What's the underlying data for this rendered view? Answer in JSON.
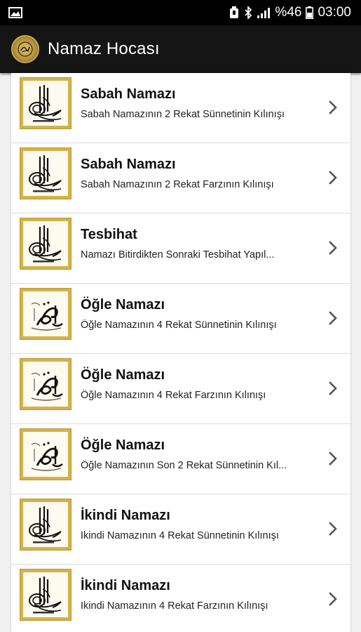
{
  "status_bar": {
    "icons": [
      "image-icon",
      "alarm-icon",
      "bluetooth-icon",
      "signal-icon",
      "battery-icon"
    ],
    "battery": "%46",
    "time": "03:00"
  },
  "app_bar": {
    "title": "Namaz Hocası",
    "logo_icon": "app-logo-icon"
  },
  "colors": {
    "app_bar_bg": "#151515",
    "status_bar_bg": "#000000",
    "frame_gold": "#d4b24a"
  },
  "items": [
    {
      "title": "Sabah Namazı",
      "subtitle": "Sabah Namazının 2 Rekat Sünnetinin Kılınışı",
      "icon": "tughra-calligraphy-icon"
    },
    {
      "title": "Sabah Namazı",
      "subtitle": "Sabah Namazının 2 Rekat Farzının Kılınışı",
      "icon": "tughra-calligraphy-icon"
    },
    {
      "title": "Tesbihat",
      "subtitle": "Namazı Bitirdikten Sonraki Tesbihat Yapıl...",
      "icon": "tughra-calligraphy-icon"
    },
    {
      "title": "Öğle Namazı",
      "subtitle": "Öğle Namazının 4 Rekat Sünnetinin Kılınışı",
      "icon": "muhammad-calligraphy-icon"
    },
    {
      "title": "Öğle Namazı",
      "subtitle": "Öğle Namazının 4 Rekat Farzının Kılınışı",
      "icon": "muhammad-calligraphy-icon"
    },
    {
      "title": "Öğle Namazı",
      "subtitle": "Öğle Namazının Son 2 Rekat Sünnetinin Kıl...",
      "icon": "muhammad-calligraphy-icon"
    },
    {
      "title": "İkindi Namazı",
      "subtitle": "İkindi Namazının 4 Rekat Sünnetinin Kılınışı",
      "icon": "tughra-calligraphy-icon"
    },
    {
      "title": "İkindi Namazı",
      "subtitle": "İkindi Namazının 4 Rekat Farzının Kılınışı",
      "icon": "tughra-calligraphy-icon"
    }
  ]
}
